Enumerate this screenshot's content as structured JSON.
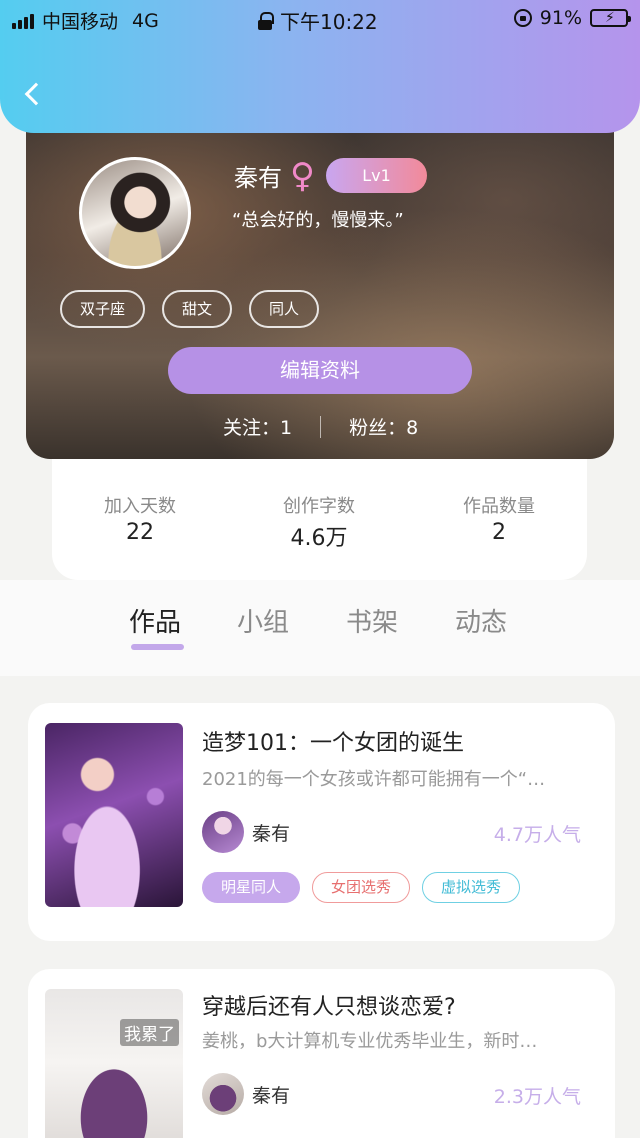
{
  "status_bar": {
    "carrier": "中国移动",
    "network": "4G",
    "time": "下午10:22",
    "battery": "91%"
  },
  "profile": {
    "name": "秦有",
    "gender_symbol": "♀",
    "level": "Lv1",
    "signature": "“总会好的，慢慢来。”",
    "tags": [
      "双子座",
      "甜文",
      "同人"
    ],
    "edit_label": "编辑资料",
    "following_label": "关注：1",
    "followers_label": "粉丝：8"
  },
  "stats": [
    {
      "label": "加入天数",
      "value": "22"
    },
    {
      "label": "创作字数",
      "value": "4.6万"
    },
    {
      "label": "作品数量",
      "value": "2"
    }
  ],
  "tabs": [
    {
      "label": "作品",
      "active": true
    },
    {
      "label": "小组",
      "active": false
    },
    {
      "label": "书架",
      "active": false
    },
    {
      "label": "动态",
      "active": false
    }
  ],
  "works": [
    {
      "title": "造梦101：一个女团的诞生",
      "desc": "2021的每一个女孩或许都可能拥有一个“…",
      "author": "秦有",
      "popularity": "4.7万人气",
      "tags": [
        "明星同人",
        "女团选秀",
        "虚拟选秀"
      ]
    },
    {
      "title": "穿越后还有人只想谈恋爱?",
      "desc": "姜桃，b大计算机专业优秀毕业生，新时…",
      "author": "秦有",
      "popularity": "2.3万人气",
      "cover_text": "我累了",
      "tags": []
    }
  ],
  "colors": {
    "header_gradient_start": "#54cdf0",
    "header_gradient_end": "#b594ec",
    "accent_purple": "#b691e6",
    "level_gradient_end": "#f28a9a"
  }
}
